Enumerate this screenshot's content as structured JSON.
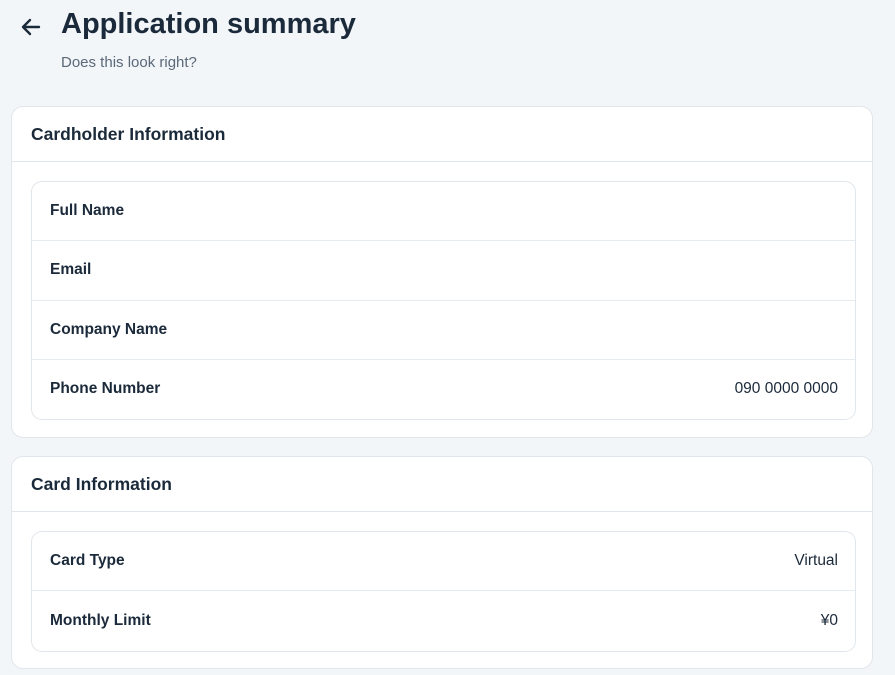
{
  "header": {
    "back_icon": "arrow-left-icon",
    "title": "Application summary",
    "subtitle": "Does this look right?"
  },
  "sections": [
    {
      "title": "Cardholder Information",
      "rows": [
        {
          "label": "Full Name",
          "value": ""
        },
        {
          "label": "Email",
          "value": ""
        },
        {
          "label": "Company Name",
          "value": ""
        },
        {
          "label": "Phone Number",
          "value": "090 0000 0000"
        }
      ]
    },
    {
      "title": "Card Information",
      "rows": [
        {
          "label": "Card Type",
          "value": "Virtual"
        },
        {
          "label": "Monthly Limit",
          "value": "¥0"
        }
      ]
    }
  ],
  "colors": {
    "background": "#f3f6f9",
    "card": "#ffffff",
    "border": "#e1e6ec",
    "text": "#1b2a3a",
    "muted": "#5a6878"
  }
}
